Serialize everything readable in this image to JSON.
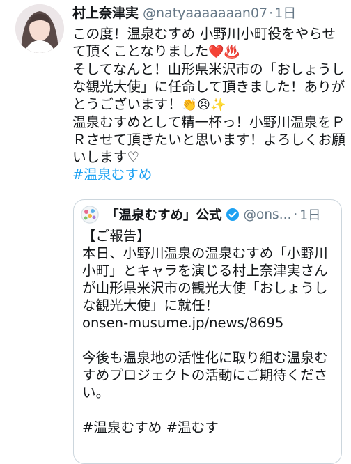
{
  "author": {
    "display_name": "村上奈津実",
    "handle": "@natyaaaaaaan07",
    "separator": "·",
    "time": "1日"
  },
  "tweet": {
    "lines": [
      "この度！温泉むすめ 小野川小町役をやらせ",
      "て頂くことなりました",
      "そしてなんと！山形県米沢市の「おしょうし",
      "な観光大使」に任命して頂きました！ありが",
      "とうございます！",
      "温泉むすめとして精一杯っ！小野川温泉をＰ",
      "Ｒさせて頂きたいと思います！よろしくお願",
      "いします♡"
    ],
    "emojis": {
      "heart": "❤️",
      "hot_springs": "♨️",
      "clap": "👏",
      "persevere": "😣",
      "sparkles": "✨"
    },
    "hashtag": "#温泉むすめ"
  },
  "quoted": {
    "display_name": "「温泉むすめ」公式",
    "handle": "@ons...",
    "separator": "·",
    "time": "1日",
    "lines": [
      "【ご報告】",
      "本日、小野川温泉の温泉むすめ「小野川",
      "小町」とキャラを演じる村上奈津実さん",
      "が山形県米沢市の観光大使「おしょうし",
      "な観光大使」に就任！",
      "onsen-musume.jp/news/8695",
      "今後も温泉地の活性化に取り組む温泉む",
      "すめプロジェクトの活動にご期待くださ",
      "い。",
      "#温泉むすめ #温むす"
    ]
  },
  "colors": {
    "text": "#14171a",
    "secondary": "#657786",
    "link": "#1da1f2",
    "border": "#ccd6dd"
  }
}
